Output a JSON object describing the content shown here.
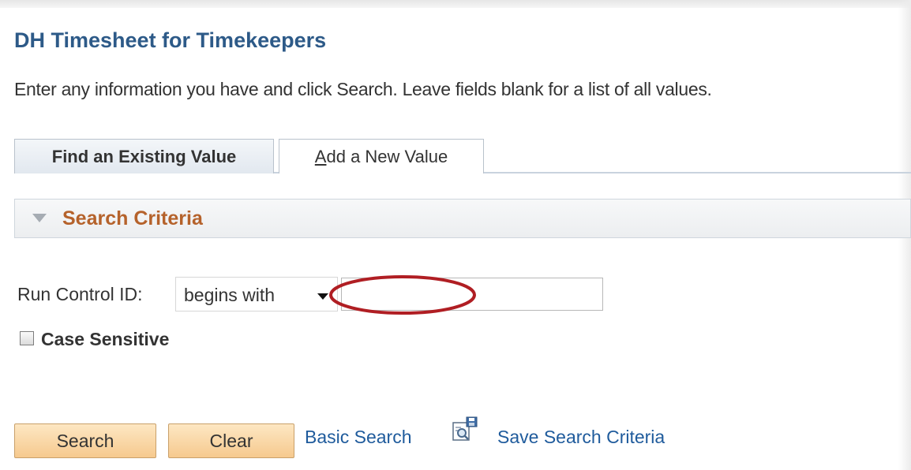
{
  "page": {
    "title": "DH Timesheet for Timekeepers",
    "instructions": "Enter any information you have and click Search. Leave fields blank for a list of all values."
  },
  "tabs": [
    {
      "label": "Find an Existing Value",
      "active": true
    },
    {
      "label_prefix": "A",
      "label_rest": "dd a New Value",
      "active": false
    }
  ],
  "search_criteria": {
    "section_title": "Search Criteria",
    "run_control": {
      "label": "Run Control ID:",
      "operator": "begins with",
      "value": ""
    },
    "case_sensitive": {
      "label": "Case Sensitive",
      "checked": false
    }
  },
  "actions": {
    "search_label": "Search",
    "clear_label": "Clear",
    "basic_search_label": "Basic Search",
    "save_search_label": "Save Search Criteria",
    "save_icon": "save-search-icon"
  },
  "colors": {
    "title": "#2d5a88",
    "section_title": "#b5622b",
    "link": "#1f5b9c",
    "button_bg": "#f6c98e",
    "highlight_ellipse": "#b01e23"
  }
}
